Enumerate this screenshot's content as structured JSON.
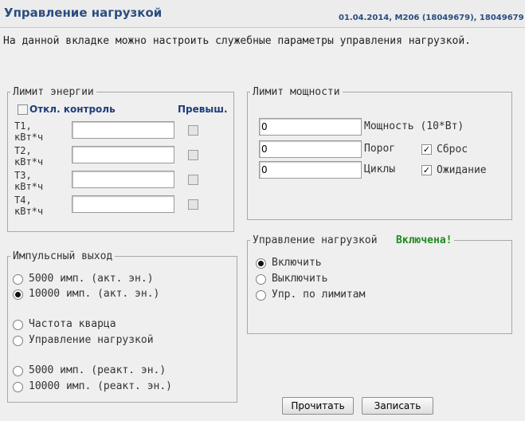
{
  "header": {
    "title": "Управление нагрузкой",
    "device_info": "01.04.2014, M206 (18049679), 18049679"
  },
  "description": "На данной вкладке можно настроить служебные параметры управления нагрузкой.",
  "energy_limit": {
    "legend": "Лимит энергии",
    "disable_control_label": "Откл. контроль",
    "disable_control_checked": false,
    "exceeded_label": "Превыш.",
    "tariffs": [
      {
        "label_line1": "T1,",
        "label_line2": "кВт*ч",
        "value": "",
        "exceeded": false
      },
      {
        "label_line1": "T2,",
        "label_line2": "кВт*ч",
        "value": "",
        "exceeded": false
      },
      {
        "label_line1": "T3,",
        "label_line2": "кВт*ч",
        "value": "",
        "exceeded": false
      },
      {
        "label_line1": "T4,",
        "label_line2": "кВт*ч",
        "value": "",
        "exceeded": false
      }
    ]
  },
  "power_limit": {
    "legend": "Лимит мощности",
    "power_value": "0",
    "power_label": "Мощность (10*Вт)",
    "threshold_value": "0",
    "threshold_label": "Порог",
    "cycles_value": "0",
    "cycles_label": "Циклы",
    "reset_label": "Сброс",
    "reset_checked": true,
    "wait_label": "Ожидание",
    "wait_checked": true
  },
  "pulse_output": {
    "legend": "Импульсный выход",
    "options": [
      {
        "label": "5000 имп. (акт. эн.)",
        "selected": false
      },
      {
        "label": "10000 имп. (акт. эн.)",
        "selected": true
      },
      {
        "label": "Частота кварца",
        "selected": false
      },
      {
        "label": "Управление нагрузкой",
        "selected": false
      },
      {
        "label": "5000 имп. (реакт. эн.)",
        "selected": false
      },
      {
        "label": "10000 имп. (реакт. эн.)",
        "selected": false
      }
    ]
  },
  "load_control": {
    "legend": "Управление нагрузкой",
    "status": "Включена!",
    "status_color": "#1e8a1e",
    "options": [
      {
        "label": "Включить",
        "selected": true
      },
      {
        "label": "Выключить",
        "selected": false
      },
      {
        "label": "Упр. по лимитам",
        "selected": false
      }
    ]
  },
  "buttons": {
    "read_label": "Прочитать",
    "write_label": "Записать"
  },
  "colors": {
    "title": "#2a4d80",
    "background": "#efefef"
  }
}
